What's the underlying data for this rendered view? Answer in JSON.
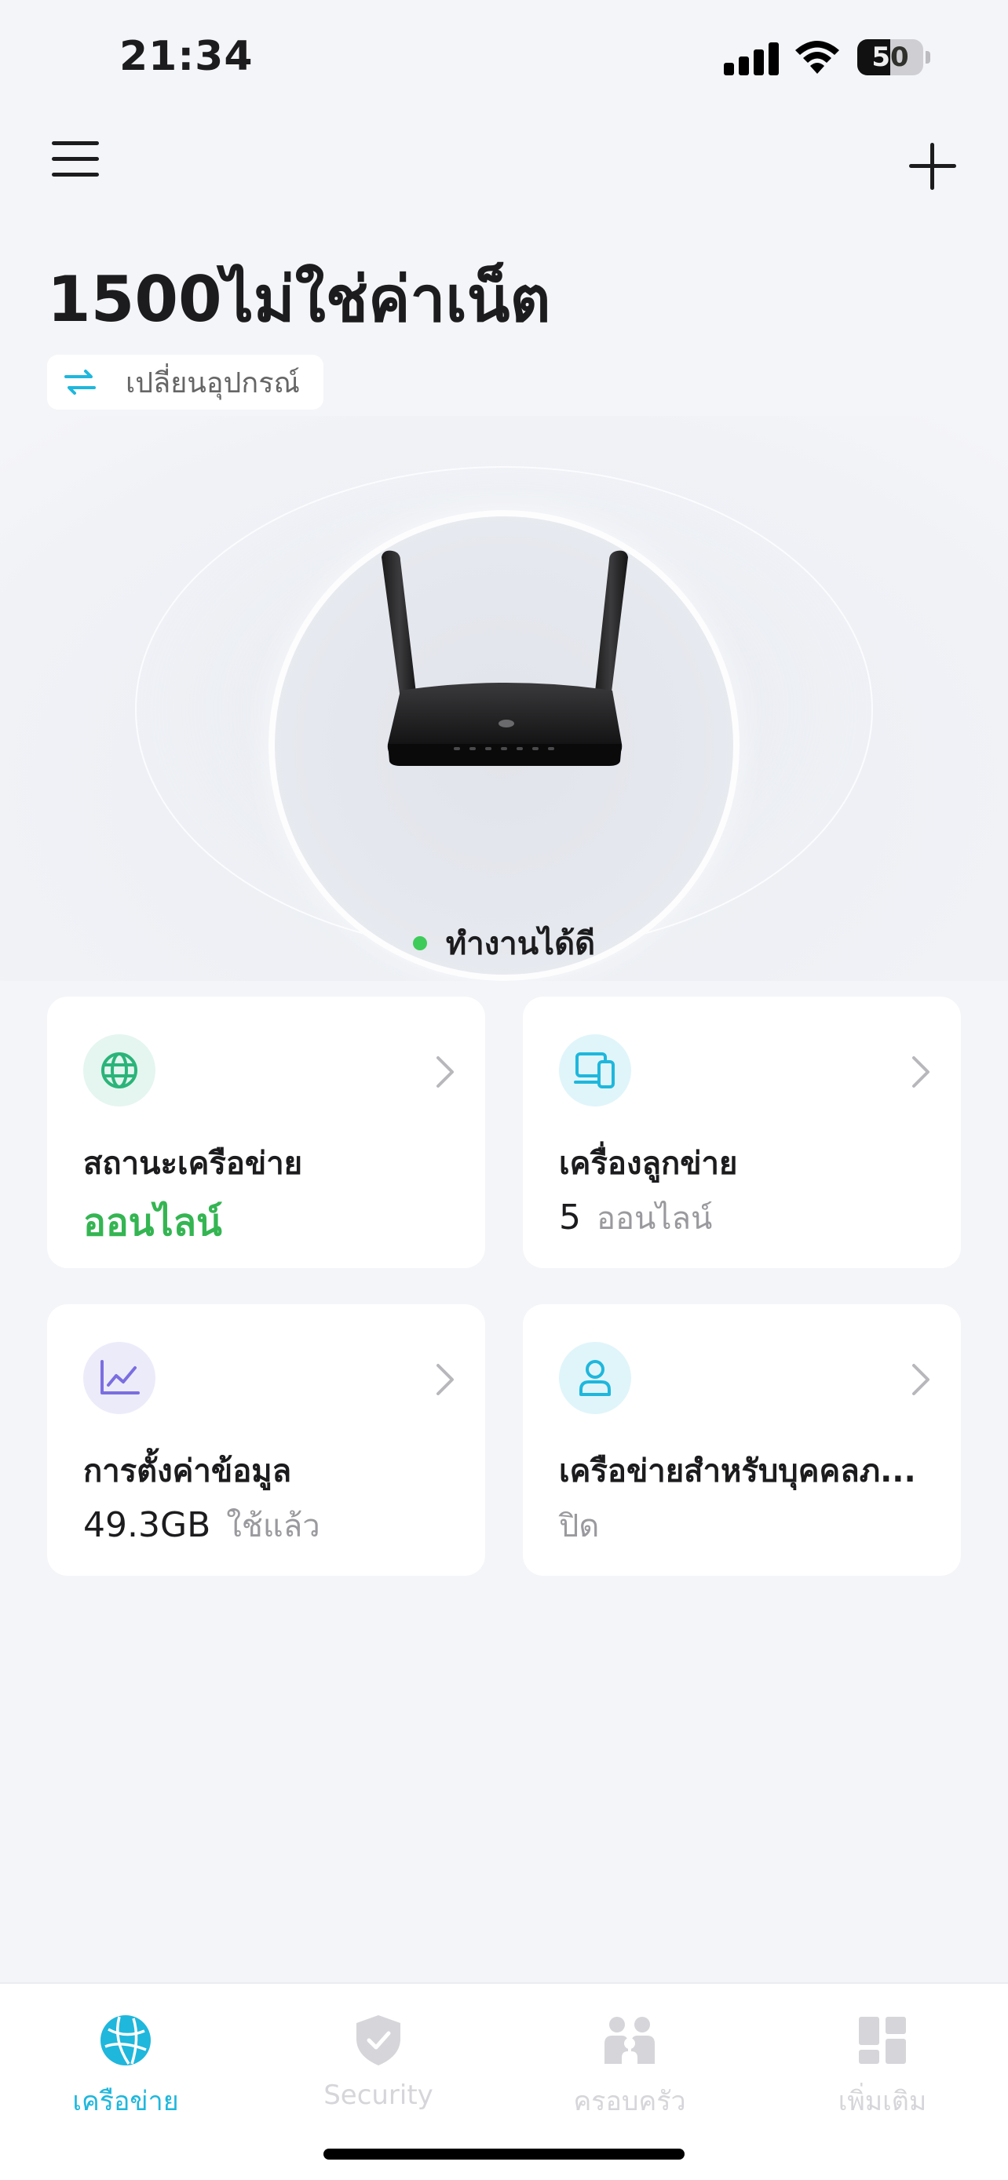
{
  "status_bar": {
    "time": "21:34",
    "battery_level": "50",
    "battery_fraction": 0.5,
    "icons": [
      "cellular-signal-icon",
      "wifi-icon",
      "battery-icon"
    ]
  },
  "header": {
    "menu_icon": "hamburger-menu-icon",
    "add_icon": "plus-icon",
    "device_name": "1500ไม่ใช่ค่าเน็ต",
    "switch_device_label": "เปลี่ยนอุปกรณ์",
    "switch_icon": "swap-arrows-icon"
  },
  "router": {
    "image": "router-image",
    "status_text": "ทำงานได้ดี",
    "status_color": "#3ecb5a"
  },
  "cards": [
    {
      "id": "network-status",
      "icon": "globe-icon",
      "icon_bg": "#e4f6ef",
      "icon_color": "#2bb47a",
      "title": "สถานะเครือข่าย",
      "value": "ออนไลน์"
    },
    {
      "id": "clients",
      "icon": "devices-icon",
      "icon_bg": "#e0f5fa",
      "icon_color": "#1fb7dc",
      "title": "เครื่องลูกข่าย",
      "count": "5",
      "unit": "ออนไลน์"
    },
    {
      "id": "data-settings",
      "icon": "line-chart-icon",
      "icon_bg": "#ecebfa",
      "icon_color": "#7b6ee0",
      "title": "การตั้งค่าข้อมูล",
      "count": "49.3GB",
      "unit": "ใช้แล้ว"
    },
    {
      "id": "guest-network",
      "icon": "person-icon",
      "icon_bg": "#e0f5fa",
      "icon_color": "#1fb7dc",
      "title": "เครือข่ายสำหรับบุคคลภ...",
      "unit": "ปิด"
    }
  ],
  "tabs": [
    {
      "label": "เครือข่าย",
      "icon": "network-globe-icon",
      "active": true
    },
    {
      "label": "Security",
      "icon": "shield-check-icon",
      "active": false
    },
    {
      "label": "ครอบครัว",
      "icon": "family-icon",
      "active": false
    },
    {
      "label": "เพิ่มเติม",
      "icon": "more-grid-icon",
      "active": false
    }
  ],
  "colors": {
    "accent": "#1fb7dc",
    "online_green": "#34b552",
    "background": "#f4f5f8"
  }
}
